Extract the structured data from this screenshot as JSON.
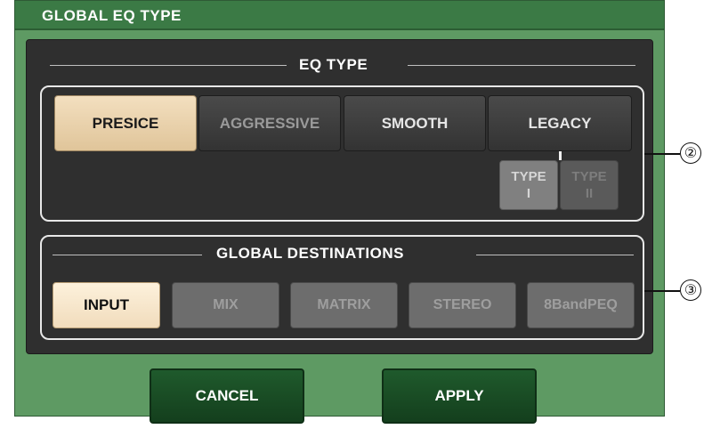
{
  "dialog": {
    "title": "GLOBAL EQ TYPE"
  },
  "eq_type": {
    "heading": "EQ TYPE",
    "options": [
      "PRESICE",
      "AGGRESSIVE",
      "SMOOTH",
      "LEGACY"
    ],
    "selected": "PRESICE",
    "legacy_types": [
      {
        "label_top": "TYPE",
        "label_bottom": "I",
        "state": "active"
      },
      {
        "label_top": "TYPE",
        "label_bottom": "II",
        "state": "inactive"
      }
    ]
  },
  "global_destinations": {
    "heading": "GLOBAL DESTINATIONS",
    "options": [
      "INPUT",
      "MIX",
      "MATRIX",
      "STEREO",
      "8BandPEQ"
    ],
    "selected": "INPUT"
  },
  "actions": {
    "cancel_label": "CANCEL",
    "apply_label": "APPLY"
  },
  "callouts": [
    "②",
    "③"
  ]
}
